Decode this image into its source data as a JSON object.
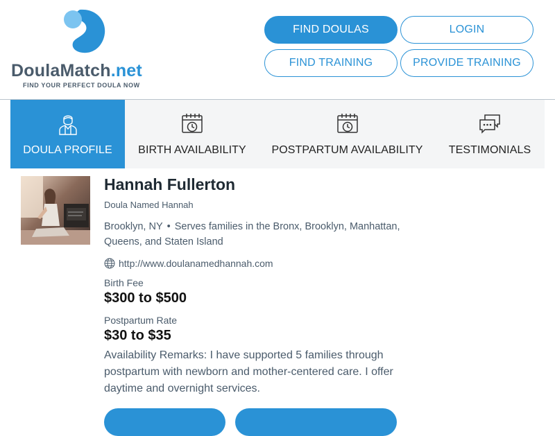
{
  "brand": {
    "name_main": "Doula",
    "name_mid": "Match",
    "name_net": ".net",
    "tagline": "FIND YOUR PERFECT DOULA NOW",
    "accent": "#2a92d6",
    "text_color": "#4a5b6b"
  },
  "nav": {
    "find_doulas": "FIND DOULAS",
    "login": "LOGIN",
    "find_training": "FIND TRAINING",
    "provide_training": "PROVIDE TRAINING"
  },
  "tabs": [
    {
      "label": "DOULA PROFILE",
      "icon": "doula-person-icon",
      "active": true
    },
    {
      "label": "BIRTH AVAILABILITY",
      "icon": "calendar-clock-icon",
      "active": false
    },
    {
      "label": "POSTPARTUM AVAILABILITY",
      "icon": "calendar-clock-icon",
      "active": false
    },
    {
      "label": "TESTIMONIALS",
      "icon": "chat-bubbles-icon",
      "active": false
    }
  ],
  "profile": {
    "name": "Hannah Fullerton",
    "business": "Doula Named Hannah",
    "city": "Brooklyn, NY",
    "bullet": "•",
    "serves": "Serves families in the Bronx, Brooklyn, Manhattan, Queens, and Staten Island",
    "website": "http://www.doulanamedhannah.com",
    "birth_fee_label": "Birth Fee",
    "birth_fee": "$300 to $500",
    "postpartum_label": "Postpartum Rate",
    "postpartum_rate": "$30 to $35",
    "remarks": "Availability Remarks: I have supported 5 families through postpartum with newborn and mother-centered care. I offer daytime and overnight services."
  }
}
